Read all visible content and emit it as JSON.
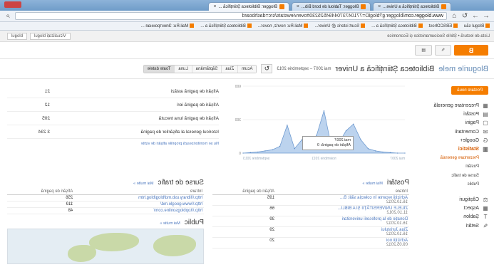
{
  "browser": {
    "tabs": [
      "Biblioteca Științifică a Unive...",
      "Blogger: Tabloul de bord Bib...",
      "Blogger: Biblioteca Științifică ..."
    ],
    "url_host": "www.blogger.com",
    "url_path": "/blogger.g?blogID=7710473704494525230#overviewstats/src=dashboard",
    "bookmarks": [
      "Blogul său",
      "EBSCOhost",
      "Biblioteca Științifică a ...",
      "Scurt istoric @ Univer...",
      "Mail.Ru: novriz, novor...",
      "Biblioteca Științifică a ...",
      "Mail.Ru: Электронная ..."
    ]
  },
  "bloggerbar": {
    "notice": "Lista de lectură • Știrile Socioumanistice și Economice",
    "view_blog": "Vizualizați blogul",
    "blog_select": "blogul"
  },
  "toolbar": {
    "logo": "B",
    "edit_icon": "✎",
    "page_icon": "▤"
  },
  "header": {
    "bloglist": "Blogurile mele",
    "blogname": "Biblioteca Științifică a Univer",
    "range": "mai 2007 – septembrie 2013",
    "periods": [
      "Acum",
      "Ziua",
      "Săptămâna",
      "Luna",
      "Toate datele"
    ]
  },
  "sidebar": {
    "new_post": "Postare nouă",
    "items": [
      {
        "icon": "▦",
        "label": "Prezentare generală"
      },
      {
        "icon": "▤",
        "label": "Postări"
      },
      {
        "icon": "▢",
        "label": "Pagini"
      },
      {
        "icon": "✉",
        "label": "Comentarii"
      },
      {
        "icon": "G",
        "label": "Google+"
      },
      {
        "icon": "▥",
        "label": "Statistici"
      }
    ],
    "subitems": [
      "Prezentare generală",
      "Postări",
      "Surse de trafic",
      "Public"
    ],
    "tools": [
      {
        "icon": "⚖",
        "label": "Câștiguri"
      },
      {
        "icon": "▦",
        "label": "Aspect"
      },
      {
        "icon": "T",
        "label": "Șablon"
      },
      {
        "icon": "✎",
        "label": "Setări"
      }
    ]
  },
  "overview": {
    "rows": [
      {
        "label": "Afișări de pagină astăzi",
        "value": "21"
      },
      {
        "label": "Afișări de pagină ieri",
        "value": "12"
      },
      {
        "label": "Afișări de pagină luna trecută",
        "value": "205"
      },
      {
        "label": "Istoricul general al afișărilor de pagină",
        "value": "3 234"
      }
    ],
    "track_link": "Nu se monitorizează propriile afișări de vizite"
  },
  "chart_data": {
    "type": "area",
    "y_ticks": [
      "600",
      "300",
      "0"
    ],
    "ylim": [
      0,
      600
    ],
    "x_labels": [
      "mai 2007",
      "noiembrie 2011",
      "septembrie 2013"
    ],
    "values": [
      0,
      0,
      5,
      10,
      20,
      40,
      120,
      260,
      200,
      90,
      60,
      380,
      160,
      80,
      120,
      40,
      250,
      60,
      30,
      20,
      10,
      5,
      0
    ],
    "tooltip": [
      "mai 2007",
      "Afișări de pagină: 0"
    ]
  },
  "posts": {
    "title": "Postări",
    "more": "Mai multe »",
    "headers": [
      "Intrare",
      "Afișări de pagină"
    ],
    "rows": [
      {
        "title": "Achiziții recente în colecția sălii: B...",
        "date": "16.10.2012",
        "views": "195"
      },
      {
        "title": "ZILELE UNIVERSITĂȚII ȘI A BIBLI...",
        "date": "11.10.2012",
        "views": "66"
      },
      {
        "title": "Donație de la profesorii universitari",
        "date": "16.10.2012",
        "views": "39"
      },
      {
        "title": "Ziua Juristului",
        "date": "16.10.2012",
        "views": "29"
      },
      {
        "title": "Achiziții noi",
        "date": "09.05.2012",
        "views": "20"
      }
    ]
  },
  "traffic": {
    "title": "Surse de trafic",
    "more": "Mai multe »",
    "headers": [
      "Intrare",
      "Afișări de pagină"
    ],
    "rows": [
      {
        "url": "http://library.usb.md/blog/blog.htm",
        "views": "256"
      },
      {
        "url": "http://www.google.md/",
        "views": "119"
      },
      {
        "url": "http://topblogsonline.com/",
        "views": "48"
      }
    ]
  },
  "audience": {
    "title": "Public",
    "more": "Mai multe »"
  }
}
